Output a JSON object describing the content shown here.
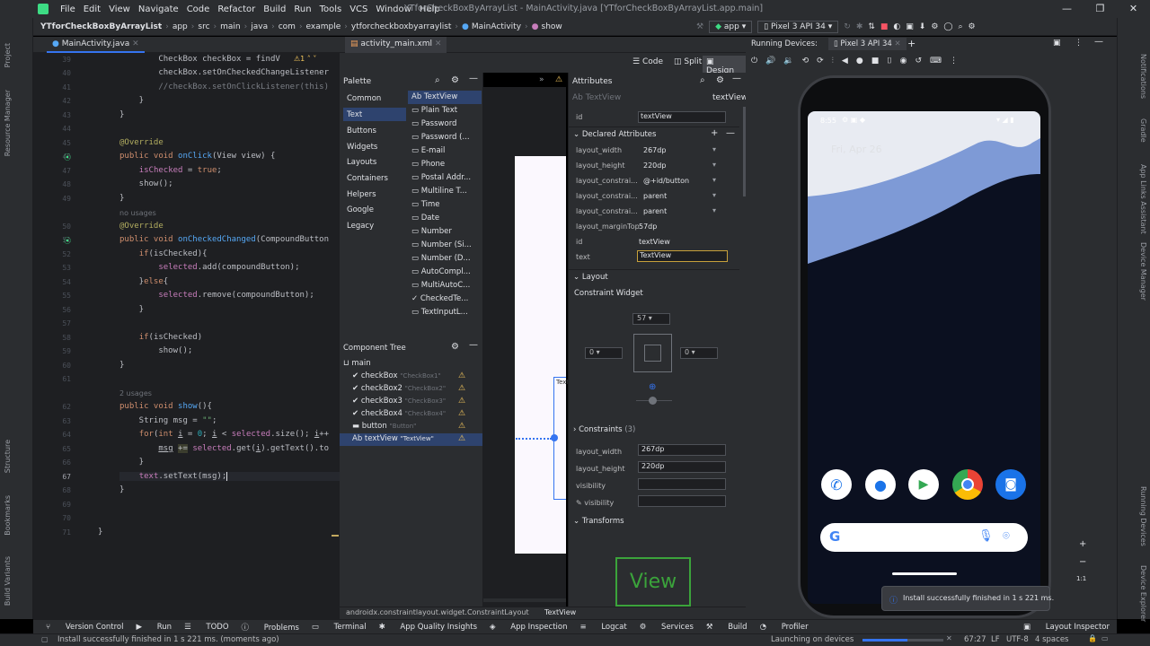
{
  "window": {
    "title": "YTforCheckBoxByArrayList - MainActivity.java [YTforCheckBoxByArrayList.app.main]",
    "menu": [
      "File",
      "Edit",
      "View",
      "Navigate",
      "Code",
      "Refactor",
      "Build",
      "Run",
      "Tools",
      "VCS",
      "Window",
      "Help"
    ]
  },
  "breadcrumb": [
    "YTforCheckBoxByArrayList",
    "app",
    "src",
    "main",
    "java",
    "com",
    "example",
    "ytforcheckboxbyarraylist",
    "MainActivity",
    "show"
  ],
  "run_config": {
    "config": "app",
    "device": "Pixel 3 API 34"
  },
  "editor": {
    "tab": "MainActivity.java",
    "hints": {
      "no_usages": "no usages",
      "two_usages": "2 usages"
    },
    "lines": {
      "l39": "39",
      "l40": "40",
      "l41": "41",
      "l42": "42",
      "l43": "43",
      "l44": "44",
      "l45": "45",
      "l46": "46",
      "l47": "47",
      "l48": "48",
      "l49": "49",
      "l50": "50",
      "l51": "51",
      "l52": "52",
      "l53": "53",
      "l54": "54",
      "l55": "55",
      "l56": "56",
      "l57": "57",
      "l58": "58",
      "l59": "59",
      "l60": "60",
      "l61": "61",
      "l62": "62",
      "l63": "63",
      "l64": "64",
      "l65": "65",
      "l66": "66",
      "l67": "67",
      "l68": "68",
      "l69": "69",
      "l70": "70",
      "l71": "71"
    },
    "warning_count": "1"
  },
  "design": {
    "tab": "activity_main.xml",
    "modes": [
      "Code",
      "Split",
      "Design"
    ],
    "palette_title": "Palette",
    "palette_categories": [
      "Common",
      "Text",
      "Buttons",
      "Widgets",
      "Layouts",
      "Containers",
      "Helpers",
      "Google",
      "Legacy"
    ],
    "palette_items": [
      "TextView",
      "Plain Text",
      "Password",
      "Password (...",
      "E-mail",
      "Phone",
      "Postal Addr...",
      "Multiline T...",
      "Time",
      "Date",
      "Number",
      "Number (Si...",
      "Number (D...",
      "AutoCompl...",
      "MultiAutoC...",
      "CheckedTe...",
      "TextInputL..."
    ],
    "toolbar_margin": "0dp",
    "component_tree_title": "Component Tree",
    "tree": [
      {
        "name": "main",
        "hint": ""
      },
      {
        "name": "checkBox",
        "hint": "\"CheckBox1\""
      },
      {
        "name": "checkBox2",
        "hint": "\"CheckBox2\""
      },
      {
        "name": "checkBox3",
        "hint": "\"CheckBox3\""
      },
      {
        "name": "checkBox4",
        "hint": "\"CheckBox4\""
      },
      {
        "name": "button",
        "hint": "\"Button\""
      },
      {
        "name": "textView",
        "hint": "\"TextView\""
      }
    ],
    "canvas_textview_label": "Text",
    "status_path": "androidx.constraintlayout.widget.ConstraintLayout",
    "status_selected": "TextView"
  },
  "attributes": {
    "title": "Attributes",
    "widget_type": "TextView",
    "widget_type_right": "textView",
    "id": "textView",
    "declared_title": "Declared Attributes",
    "declared": [
      {
        "k": "layout_width",
        "v": "267dp"
      },
      {
        "k": "layout_height",
        "v": "220dp"
      },
      {
        "k": "layout_constrai...",
        "v": "@+id/button"
      },
      {
        "k": "layout_constrai...",
        "v": "parent"
      },
      {
        "k": "layout_constrai...",
        "v": "parent"
      },
      {
        "k": "layout_marginTop",
        "v": "57dp"
      },
      {
        "k": "id",
        "v": "textView"
      },
      {
        "k": "text",
        "v": "TextView"
      }
    ],
    "layout_title": "Layout",
    "constraint_widget": "Constraint Widget",
    "margin_top": "57",
    "margin_left": "0",
    "margin_right": "0",
    "constraints": "Constraints",
    "constraints_count": "(3)",
    "layout_width": "267dp",
    "layout_height": "220dp",
    "visibility": "visibility",
    "visibility_tools": "visibility",
    "transforms": "Transforms",
    "view_preview": "View"
  },
  "running_devices": {
    "title": "Running Devices:",
    "tab": "Pixel 3 API 34",
    "phone_time": "8:55",
    "phone_date": "Fri, Apr 26",
    "toast": "Install successfully finished in 1 s 221 ms.",
    "zoom": "1:1"
  },
  "bottom_tools": [
    "Version Control",
    "Run",
    "TODO",
    "Problems",
    "Terminal",
    "App Quality Insights",
    "App Inspection",
    "Logcat",
    "Services",
    "Build",
    "Profiler"
  ],
  "layout_inspector": "Layout Inspector",
  "status": {
    "message": "Install successfully finished in 1 s 221 ms. (moments ago)",
    "task": "Launching on devices",
    "position": "67:27",
    "line_sep": "LF",
    "encoding": "UTF-8",
    "indent": "4 spaces"
  },
  "side_left": [
    "Project",
    "Resource Manager",
    "Structure",
    "Bookmarks",
    "Build Variants"
  ],
  "side_right": [
    "Notifications",
    "Gradle",
    "App Links Assistant",
    "Device Manager",
    "Running Devices",
    "Device Explorer"
  ]
}
